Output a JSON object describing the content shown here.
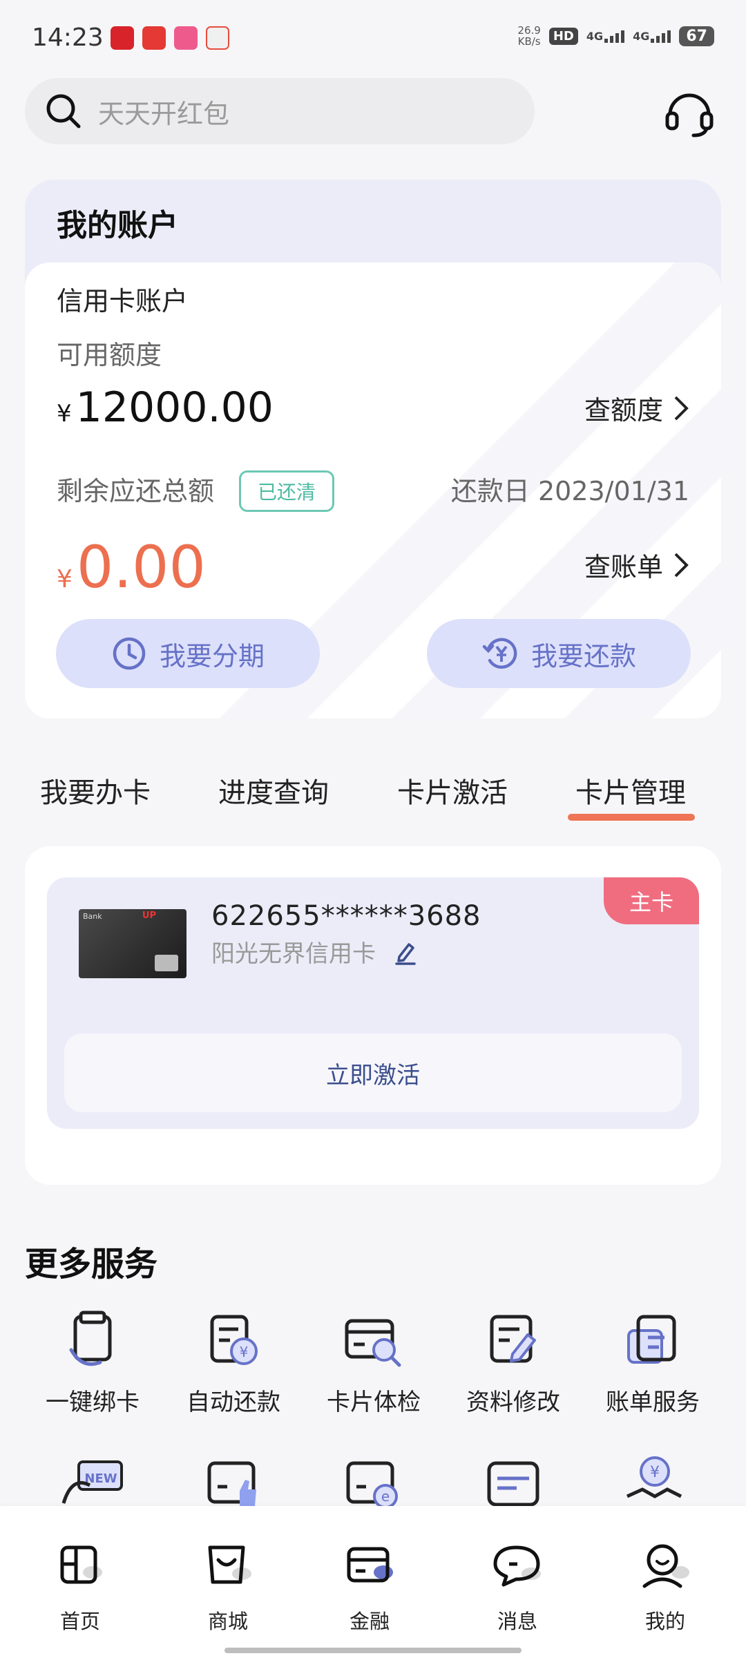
{
  "status_bar": {
    "time": "14:23",
    "net_speed_value": "26.9",
    "net_speed_unit": "KB/s",
    "hd_label": "HD",
    "network_1": "4G",
    "network_2": "4G",
    "battery": "67"
  },
  "search": {
    "placeholder": "天天开红包",
    "icon": "search-icon"
  },
  "support_icon": "headset-icon",
  "account": {
    "section_title": "我的账户",
    "card_account_title": "信用卡账户",
    "available_label": "可用额度",
    "currency": "¥",
    "available_amount": "12000.00",
    "check_limit_label": "查额度",
    "balance_label": "剩余应还总额",
    "settled_badge": "已还清",
    "due_date_text": "还款日 2023/01/31",
    "due_amount": "0.00",
    "check_bill_label": "查账单",
    "installment_label": "我要分期",
    "repay_label": "我要还款"
  },
  "tabs": [
    {
      "label": "我要办卡",
      "active": false
    },
    {
      "label": "进度查询",
      "active": false
    },
    {
      "label": "卡片激活",
      "active": false
    },
    {
      "label": "卡片管理",
      "active": true
    }
  ],
  "card": {
    "number": "622655******3688",
    "name": "阳光无界信用卡",
    "primary_badge": "主卡",
    "activate_label": "立即激活",
    "thumb_bank_text": "Bank",
    "thumb_up_text": "UP"
  },
  "more_services": {
    "title": "更多服务",
    "items": [
      {
        "label": "一键绑卡",
        "icon": "phone-bind-card-icon"
      },
      {
        "label": "自动还款",
        "icon": "auto-repay-icon"
      },
      {
        "label": "卡片体检",
        "icon": "card-check-icon"
      },
      {
        "label": "资料修改",
        "icon": "edit-info-icon"
      },
      {
        "label": "账单服务",
        "icon": "bill-service-icon"
      }
    ],
    "row2_icons": [
      "new-card-icon",
      "card-like-icon",
      "card-e-icon",
      "card-list-icon",
      "gift-yuan-icon"
    ],
    "row2_badge_text": "NEW"
  },
  "bottom_nav": [
    {
      "label": "首页",
      "icon": "home-icon"
    },
    {
      "label": "商城",
      "icon": "mall-bag-icon"
    },
    {
      "label": "金融",
      "icon": "wallet-icon"
    },
    {
      "label": "消息",
      "icon": "message-icon"
    },
    {
      "label": "我的",
      "icon": "profile-icon"
    }
  ],
  "colors": {
    "accent_orange": "#ee7555",
    "primary_badge": "#f06d7f",
    "action_blue": "#6672c8",
    "card_bg": "#ececf9"
  }
}
